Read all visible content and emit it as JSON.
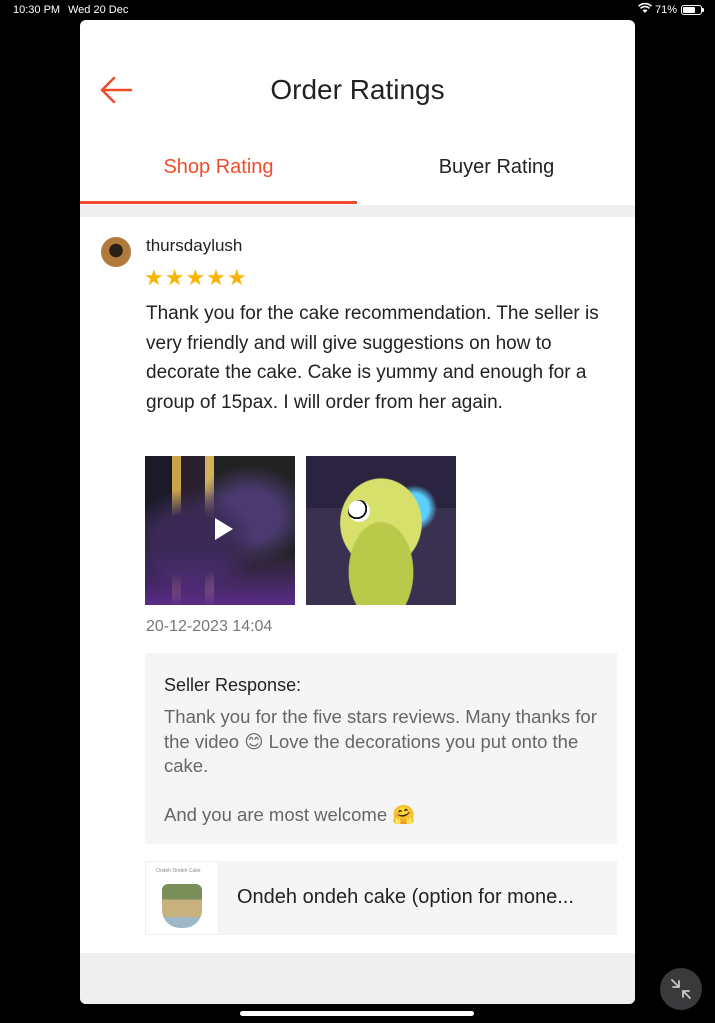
{
  "status_bar": {
    "time": "10:30 PM",
    "date": "Wed 20 Dec",
    "battery_percent_label": "71%",
    "battery_level": 0.71
  },
  "header": {
    "title": "Order Ratings",
    "back_icon": "arrow-left-icon",
    "accent_color": "#ee4d2d"
  },
  "tabs": [
    {
      "label": "Shop Rating",
      "active": true
    },
    {
      "label": "Buyer Rating",
      "active": false
    }
  ],
  "review": {
    "username": "thursdaylush",
    "rating": 5,
    "stars": "★★★★★",
    "text": "Thank you for the cake recommendation. The seller is very friendly and will give suggestions on how to decorate the cake. Cake is yummy and enough for a group of 15pax. I will order from her again.",
    "timestamp": "20-12-2023 14:04",
    "media": [
      {
        "type": "video",
        "icon": "play-icon"
      },
      {
        "type": "photo"
      }
    ],
    "seller_response": {
      "label": "Seller Response:",
      "text": "Thank you for the five stars reviews. Many thanks for the video 😊 Love the decorations you put onto the cake.\n\nAnd you are most welcome 🤗"
    },
    "product": {
      "name": "Ondeh ondeh cake (option for mone...",
      "thumb_caption": "Ondeh Ondeh Cake"
    }
  }
}
